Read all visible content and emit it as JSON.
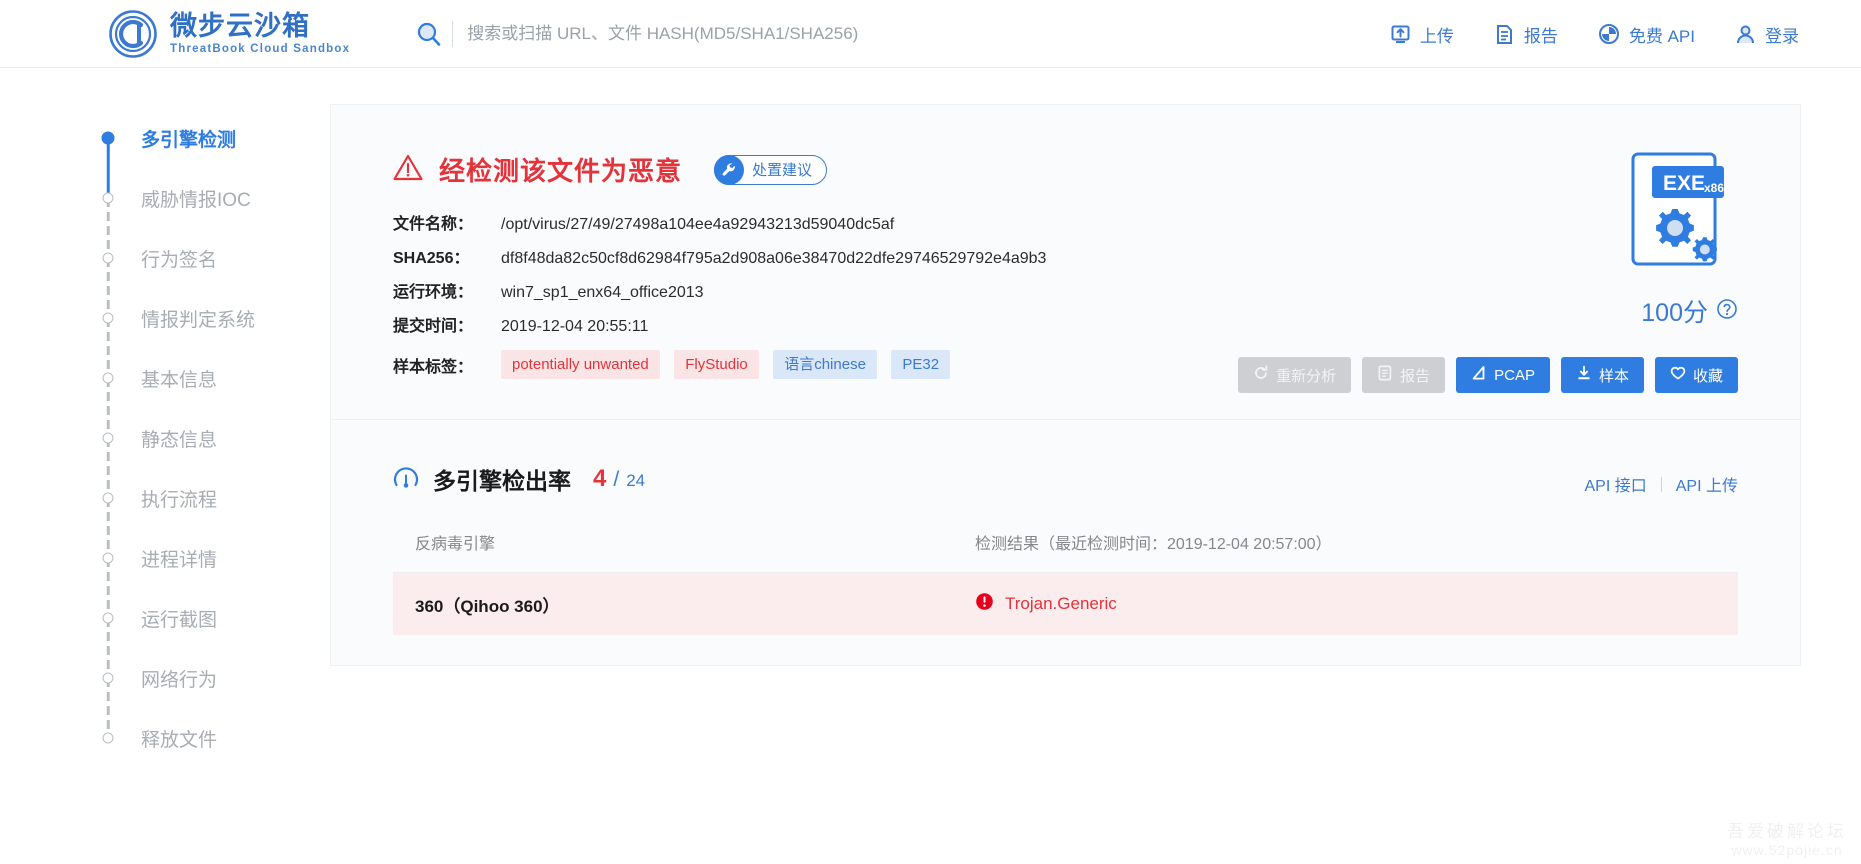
{
  "header": {
    "brand_cn": "微步云沙箱",
    "brand_en": "ThreatBook Cloud Sandbox",
    "search_placeholder": "搜索或扫描 URL、文件 HASH(MD5/SHA1/SHA256)",
    "search_value": "",
    "nav": [
      {
        "label": "上传",
        "icon": "upload-icon"
      },
      {
        "label": "报告",
        "icon": "report-icon"
      },
      {
        "label": "免费 API",
        "icon": "api-icon"
      },
      {
        "label": "登录",
        "icon": "user-icon"
      }
    ]
  },
  "sidebar": {
    "items": [
      {
        "label": "多引擎检测",
        "active": true
      },
      {
        "label": "威胁情报IOC",
        "active": false
      },
      {
        "label": "行为签名",
        "active": false
      },
      {
        "label": "情报判定系统",
        "active": false
      },
      {
        "label": "基本信息",
        "active": false
      },
      {
        "label": "静态信息",
        "active": false
      },
      {
        "label": "执行流程",
        "active": false
      },
      {
        "label": "进程详情",
        "active": false
      },
      {
        "label": "运行截图",
        "active": false
      },
      {
        "label": "网络行为",
        "active": false
      },
      {
        "label": "释放文件",
        "active": false
      }
    ]
  },
  "summary": {
    "verdict": "经检测该文件为恶意",
    "advice_button": "处置建议",
    "fields": [
      {
        "key": "文件名称：",
        "value": "/opt/virus/27/49/27498a104ee4a92943213d59040dc5af"
      },
      {
        "key": "SHA256：",
        "value": "df8f48da82c50cf8d62984f795a2d908a06e38470d22dfe29746529792e4a9b3"
      },
      {
        "key": "运行环境：",
        "value": "win7_sp1_enx64_office2013"
      },
      {
        "key": "提交时间：",
        "value": "2019-12-04 20:55:11"
      }
    ],
    "tags_key": "样本标签：",
    "tags": [
      {
        "label": "potentially unwanted",
        "kind": "red"
      },
      {
        "label": "FlyStudio",
        "kind": "red"
      },
      {
        "label": "语言chinese",
        "kind": "blue"
      },
      {
        "label": "PE32",
        "kind": "blue"
      }
    ],
    "file_type": "EXE",
    "file_arch": "x86",
    "score": "100分",
    "buttons": [
      {
        "label": "重新分析",
        "state": "disabled",
        "icon": "refresh-icon"
      },
      {
        "label": "报告",
        "state": "disabled",
        "icon": "report-icon"
      },
      {
        "label": "PCAP",
        "state": "primary",
        "icon": "pcap-icon"
      },
      {
        "label": "样本",
        "state": "primary",
        "icon": "download-icon"
      },
      {
        "label": "收藏",
        "state": "primary",
        "icon": "heart-icon"
      }
    ]
  },
  "detection": {
    "title": "多引擎检出率",
    "hits": "4",
    "slash": "/",
    "total": "24",
    "api_interface_link": "API 接口",
    "api_upload_link": "API 上传",
    "col_engine": "反病毒引擎",
    "col_result": "检测结果（最近检测时间：2019-12-04 20:57:00）",
    "rows": [
      {
        "engine": "360（Qihoo 360）",
        "result": "Trojan.Generic",
        "malicious": true
      }
    ]
  },
  "watermark": {
    "line1": "吾爱破解论坛",
    "line2": "www.52pojie.cn"
  }
}
